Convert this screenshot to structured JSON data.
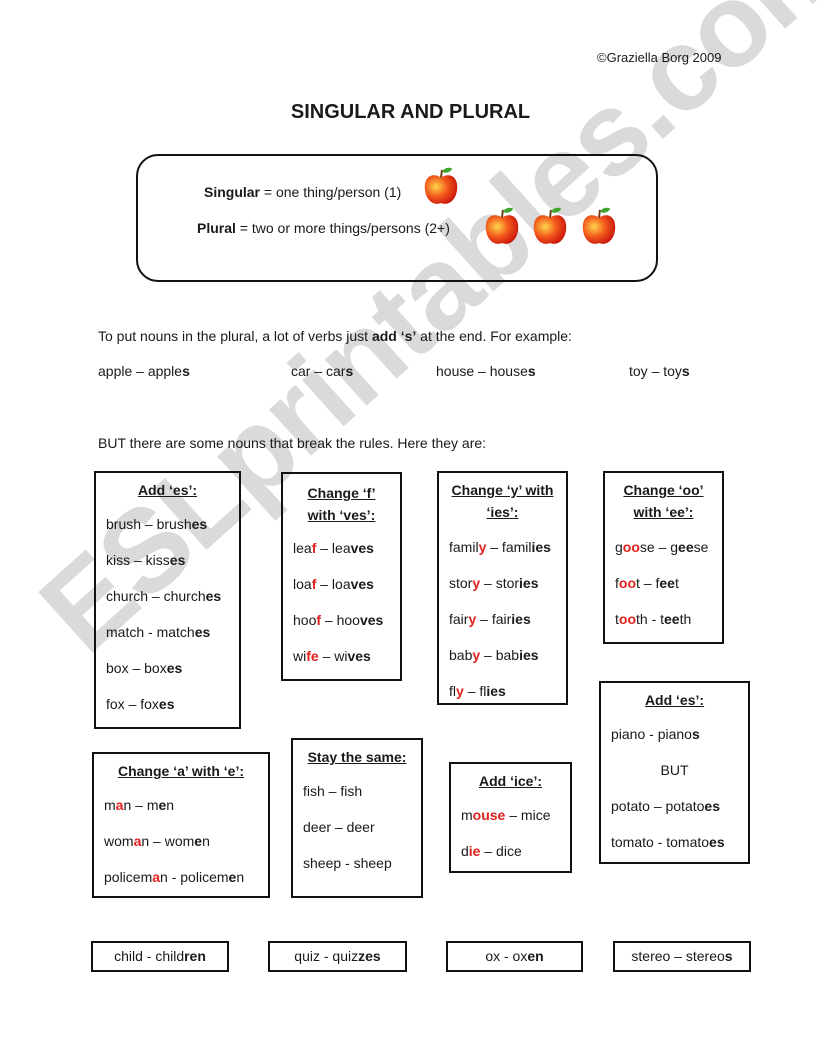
{
  "copyright": "©Graziella Borg 2009",
  "title": "SINGULAR AND PLURAL",
  "definitions": {
    "singular_term": "Singular",
    "singular_rest": " = one thing/person (1)",
    "plural_term": "Plural",
    "plural_rest": " = two or more things/persons (2+)"
  },
  "intro": {
    "pre": "To put nouns in the plural, a lot of verbs just ",
    "bold": "add ‘s’",
    "post": " at the end. For example:"
  },
  "examples": [
    {
      "base": "apple – apple",
      "end": "s"
    },
    {
      "base": "car – car",
      "end": "s"
    },
    {
      "base": "house – house",
      "end": "s"
    },
    {
      "base": "toy – toy",
      "end": "s"
    }
  ],
  "but_text": "BUT there are some nouns that break the rules. Here they are:",
  "boxes": {
    "add_es": {
      "heading": "Add ‘es’:",
      "rows": [
        [
          "brush – brush",
          "es"
        ],
        [
          "kiss – kiss",
          "es"
        ],
        [
          "church – church",
          "es"
        ],
        [
          "match - match",
          "es"
        ],
        [
          "box – box",
          "es"
        ],
        [
          "fox – fox",
          "es"
        ]
      ]
    },
    "f_ves": {
      "heading1": "Change ‘f’",
      "heading2": "with ‘ves’:",
      "rows": [
        [
          "lea",
          "f",
          " – lea",
          "ves"
        ],
        [
          "loa",
          "f",
          " – loa",
          "ves"
        ],
        [
          "hoo",
          "f",
          " – hoo",
          "ves"
        ],
        [
          "wi",
          "fe",
          " – wi",
          "ves"
        ]
      ]
    },
    "y_ies": {
      "heading1": "Change ‘y’ with",
      "heading2": "‘ies’:",
      "rows": [
        [
          "famil",
          "y",
          " – famil",
          "ies"
        ],
        [
          "stor",
          "y",
          " – stor",
          "ies"
        ],
        [
          "fair",
          "y",
          " – fair",
          "ies"
        ],
        [
          "bab",
          "y",
          " – bab",
          "ies"
        ],
        [
          "fl",
          "y",
          " – fl",
          "ies"
        ]
      ]
    },
    "oo_ee": {
      "heading1": "Change ‘oo’",
      "heading2": "with ‘ee’:",
      "rows": [
        [
          "g",
          "oo",
          "se – g",
          "ee",
          "se"
        ],
        [
          "f",
          "oo",
          "t – f",
          "ee",
          "t"
        ],
        [
          "t",
          "oo",
          "th - t",
          "ee",
          "th"
        ]
      ]
    },
    "a_e": {
      "heading": "Change ‘a’ with ‘e’:",
      "rows": [
        [
          "m",
          "a",
          "n – m",
          "e",
          "n"
        ],
        [
          "wom",
          "a",
          "n – wom",
          "e",
          "n"
        ],
        [
          "policem",
          "a",
          "n - policem",
          "e",
          "n"
        ]
      ]
    },
    "same": {
      "heading": "Stay the same:",
      "rows": [
        "fish – fish",
        "deer – deer",
        "sheep - sheep"
      ]
    },
    "ice": {
      "heading": "Add ‘ice’:",
      "rows": [
        [
          "m",
          "ouse",
          " – mice"
        ],
        [
          "d",
          "ie",
          " – dice"
        ]
      ]
    },
    "es2": {
      "heading": "Add ‘es’:",
      "row1": [
        "piano - piano",
        "s"
      ],
      "but": "BUT",
      "row2": [
        "potato – potato",
        "es"
      ],
      "row3": [
        "tomato - tomato",
        "es"
      ]
    }
  },
  "irregulars": [
    [
      "child - child",
      "ren"
    ],
    [
      "quiz - quiz",
      "zes"
    ],
    [
      "ox - ox",
      "en"
    ],
    [
      "stereo – stereo",
      "s"
    ]
  ],
  "watermark": "ESLprintables.com",
  "colors": {
    "highlight": "#e0211d",
    "watermark": "#c4c4c4"
  }
}
